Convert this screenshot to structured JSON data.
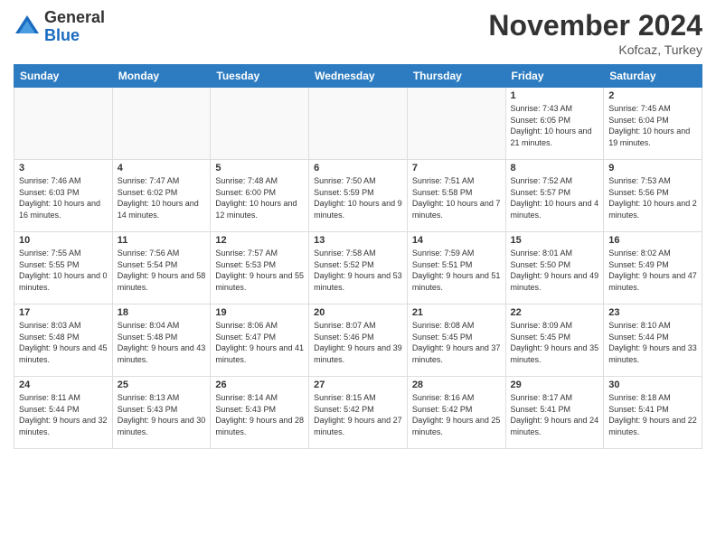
{
  "logo": {
    "general": "General",
    "blue": "Blue"
  },
  "title": "November 2024",
  "location": "Kofcaz, Turkey",
  "days_of_week": [
    "Sunday",
    "Monday",
    "Tuesday",
    "Wednesday",
    "Thursday",
    "Friday",
    "Saturday"
  ],
  "weeks": [
    [
      {
        "day": "",
        "info": ""
      },
      {
        "day": "",
        "info": ""
      },
      {
        "day": "",
        "info": ""
      },
      {
        "day": "",
        "info": ""
      },
      {
        "day": "",
        "info": ""
      },
      {
        "day": "1",
        "info": "Sunrise: 7:43 AM\nSunset: 6:05 PM\nDaylight: 10 hours and 21 minutes."
      },
      {
        "day": "2",
        "info": "Sunrise: 7:45 AM\nSunset: 6:04 PM\nDaylight: 10 hours and 19 minutes."
      }
    ],
    [
      {
        "day": "3",
        "info": "Sunrise: 7:46 AM\nSunset: 6:03 PM\nDaylight: 10 hours and 16 minutes."
      },
      {
        "day": "4",
        "info": "Sunrise: 7:47 AM\nSunset: 6:02 PM\nDaylight: 10 hours and 14 minutes."
      },
      {
        "day": "5",
        "info": "Sunrise: 7:48 AM\nSunset: 6:00 PM\nDaylight: 10 hours and 12 minutes."
      },
      {
        "day": "6",
        "info": "Sunrise: 7:50 AM\nSunset: 5:59 PM\nDaylight: 10 hours and 9 minutes."
      },
      {
        "day": "7",
        "info": "Sunrise: 7:51 AM\nSunset: 5:58 PM\nDaylight: 10 hours and 7 minutes."
      },
      {
        "day": "8",
        "info": "Sunrise: 7:52 AM\nSunset: 5:57 PM\nDaylight: 10 hours and 4 minutes."
      },
      {
        "day": "9",
        "info": "Sunrise: 7:53 AM\nSunset: 5:56 PM\nDaylight: 10 hours and 2 minutes."
      }
    ],
    [
      {
        "day": "10",
        "info": "Sunrise: 7:55 AM\nSunset: 5:55 PM\nDaylight: 10 hours and 0 minutes."
      },
      {
        "day": "11",
        "info": "Sunrise: 7:56 AM\nSunset: 5:54 PM\nDaylight: 9 hours and 58 minutes."
      },
      {
        "day": "12",
        "info": "Sunrise: 7:57 AM\nSunset: 5:53 PM\nDaylight: 9 hours and 55 minutes."
      },
      {
        "day": "13",
        "info": "Sunrise: 7:58 AM\nSunset: 5:52 PM\nDaylight: 9 hours and 53 minutes."
      },
      {
        "day": "14",
        "info": "Sunrise: 7:59 AM\nSunset: 5:51 PM\nDaylight: 9 hours and 51 minutes."
      },
      {
        "day": "15",
        "info": "Sunrise: 8:01 AM\nSunset: 5:50 PM\nDaylight: 9 hours and 49 minutes."
      },
      {
        "day": "16",
        "info": "Sunrise: 8:02 AM\nSunset: 5:49 PM\nDaylight: 9 hours and 47 minutes."
      }
    ],
    [
      {
        "day": "17",
        "info": "Sunrise: 8:03 AM\nSunset: 5:48 PM\nDaylight: 9 hours and 45 minutes."
      },
      {
        "day": "18",
        "info": "Sunrise: 8:04 AM\nSunset: 5:48 PM\nDaylight: 9 hours and 43 minutes."
      },
      {
        "day": "19",
        "info": "Sunrise: 8:06 AM\nSunset: 5:47 PM\nDaylight: 9 hours and 41 minutes."
      },
      {
        "day": "20",
        "info": "Sunrise: 8:07 AM\nSunset: 5:46 PM\nDaylight: 9 hours and 39 minutes."
      },
      {
        "day": "21",
        "info": "Sunrise: 8:08 AM\nSunset: 5:45 PM\nDaylight: 9 hours and 37 minutes."
      },
      {
        "day": "22",
        "info": "Sunrise: 8:09 AM\nSunset: 5:45 PM\nDaylight: 9 hours and 35 minutes."
      },
      {
        "day": "23",
        "info": "Sunrise: 8:10 AM\nSunset: 5:44 PM\nDaylight: 9 hours and 33 minutes."
      }
    ],
    [
      {
        "day": "24",
        "info": "Sunrise: 8:11 AM\nSunset: 5:44 PM\nDaylight: 9 hours and 32 minutes."
      },
      {
        "day": "25",
        "info": "Sunrise: 8:13 AM\nSunset: 5:43 PM\nDaylight: 9 hours and 30 minutes."
      },
      {
        "day": "26",
        "info": "Sunrise: 8:14 AM\nSunset: 5:43 PM\nDaylight: 9 hours and 28 minutes."
      },
      {
        "day": "27",
        "info": "Sunrise: 8:15 AM\nSunset: 5:42 PM\nDaylight: 9 hours and 27 minutes."
      },
      {
        "day": "28",
        "info": "Sunrise: 8:16 AM\nSunset: 5:42 PM\nDaylight: 9 hours and 25 minutes."
      },
      {
        "day": "29",
        "info": "Sunrise: 8:17 AM\nSunset: 5:41 PM\nDaylight: 9 hours and 24 minutes."
      },
      {
        "day": "30",
        "info": "Sunrise: 8:18 AM\nSunset: 5:41 PM\nDaylight: 9 hours and 22 minutes."
      }
    ]
  ]
}
